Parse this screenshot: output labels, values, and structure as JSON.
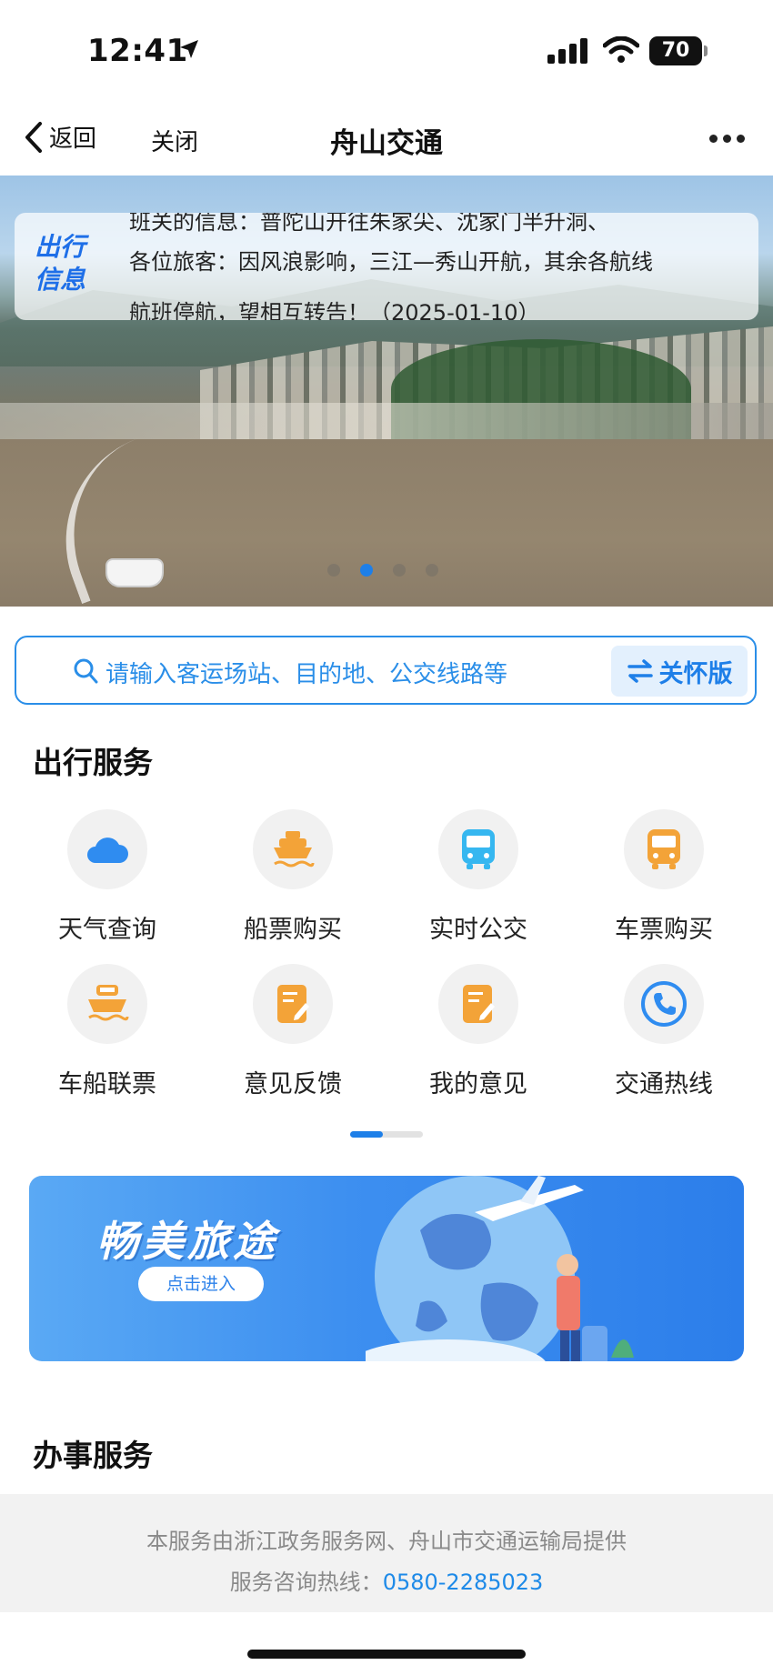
{
  "status_bar": {
    "time": "12:41",
    "battery": "70"
  },
  "nav": {
    "back_label": "返回",
    "close_label": "关闭",
    "title": "舟山交通"
  },
  "banner": {
    "badge": "出行信息",
    "notice_lines": [
      "班关的信息：普陀山开往朱家尖、沈家门半升洞、",
      "各位旅客：因风浪影响，三江—秀山开航，其余各航线",
      "航班停航，望相互转告！（2025-01-10）"
    ]
  },
  "search": {
    "placeholder": "请输入客运场站、目的地、公交线路等",
    "care_label": "关怀版"
  },
  "travel_services": {
    "title": "出行服务",
    "items": [
      {
        "label": "天气查询",
        "icon": "cloud-icon"
      },
      {
        "label": "船票购买",
        "icon": "ship-icon"
      },
      {
        "label": "实时公交",
        "icon": "bus-icon"
      },
      {
        "label": "车票购买",
        "icon": "coach-icon"
      },
      {
        "label": "车船联票",
        "icon": "ferry-car-icon"
      },
      {
        "label": "意见反馈",
        "icon": "feedback-icon"
      },
      {
        "label": "我的意见",
        "icon": "my-feedback-icon"
      },
      {
        "label": "交通热线",
        "icon": "phone-icon"
      }
    ]
  },
  "promo": {
    "title": "畅美旅途",
    "button": "点击进入"
  },
  "affairs": {
    "title": "办事服务"
  },
  "footer": {
    "line1": "本服务由浙江政务服务网、舟山市交通运输局提供",
    "hotline_label": "服务咨询热线：",
    "hotline": "0580-2285023"
  },
  "colors": {
    "accent": "#1e7fe8",
    "orange": "#f3a338",
    "bus_blue": "#36b7f0"
  }
}
